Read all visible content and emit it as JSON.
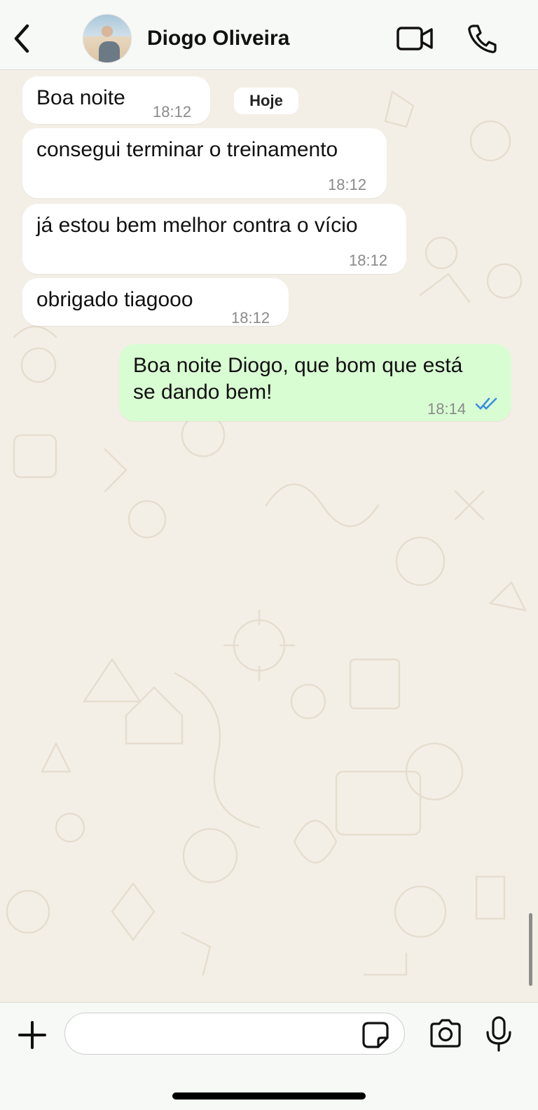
{
  "header": {
    "contact_name": "Diogo Oliveira",
    "back_icon": "chevron-left-icon",
    "video_icon": "video-camera-icon",
    "call_icon": "phone-icon"
  },
  "chat": {
    "date_separator": "Hoje",
    "messages": [
      {
        "direction": "in",
        "text": "Boa noite",
        "time": "18:12"
      },
      {
        "direction": "in",
        "text": "consegui terminar o treinamento",
        "time": "18:12"
      },
      {
        "direction": "in",
        "text": "já estou bem melhor contra o vício",
        "time": "18:12"
      },
      {
        "direction": "in",
        "text": "obrigado tiagooo",
        "time": "18:12"
      },
      {
        "direction": "out",
        "text_line1": "Boa noite Diogo, que bom que está",
        "text_line2": "se dando bem!",
        "time": "18:14",
        "status": "read"
      }
    ]
  },
  "input": {
    "placeholder": "",
    "plus_icon": "plus-icon",
    "sticker_icon": "sticker-icon",
    "camera_icon": "camera-icon",
    "mic_icon": "microphone-icon"
  },
  "colors": {
    "incoming_bubble": "#ffffff",
    "outgoing_bubble": "#d9fdd3",
    "read_ticks": "#3a8de0",
    "chat_background": "#f4efe6"
  }
}
